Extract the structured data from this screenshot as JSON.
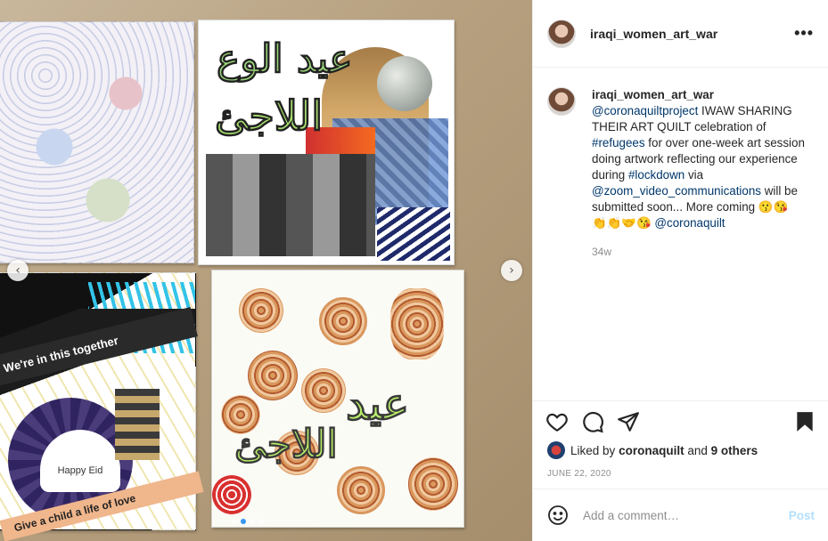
{
  "post": {
    "username": "iraqi_women_art_war",
    "more_label": "•••",
    "caption": {
      "username": "iraqi_women_art_war",
      "mention1": "@coronaquiltproject",
      "text1": " IWAW SHARING THEIR ART QUILT celebration of ",
      "tag1": "#refugees",
      "text2": " for over one-week art session doing artwork reflecting our experience during ",
      "tag2": "#lockdown",
      "text3": " via ",
      "mention2": "@zoom_video_communications",
      "text4": " will be submitted soon... More coming ",
      "emoji1": "😗😘",
      "emoji2": "👏👏🤝😘 ",
      "mention3": "@coronaquilt"
    },
    "time_ago": "34w",
    "liked_prefix": "Liked by ",
    "liked_user": "coronaquilt",
    "liked_mid": " and ",
    "liked_others": "9 others",
    "date": "JUNE 22, 2020",
    "comment_placeholder": "Add a comment…",
    "post_label": "Post"
  },
  "artwork": {
    "tile2_word1": "عيد الوع",
    "tile2_word2": "اللاجئ",
    "tile3_text1": "We're in this together",
    "tile3_text2": "Give a child a life of love",
    "tile3_text3": "Happy Eid",
    "tile4_word1": "عيد",
    "tile4_word2": "اللاجئ"
  },
  "carousel": {
    "prev": "‹",
    "next": "›"
  }
}
